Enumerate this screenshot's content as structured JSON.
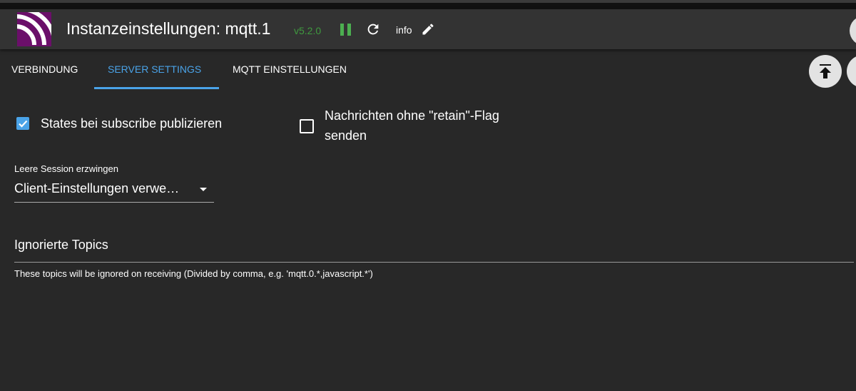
{
  "header": {
    "title": "Instanzeinstellungen: mqtt.1",
    "version": "v5.2.0",
    "info_label": "info",
    "icons": {
      "logo": "mqtt-logo",
      "pause": "pause-icon",
      "reload": "reload-icon",
      "edit": "pencil-icon"
    },
    "colors": {
      "version": "#3f9a3f",
      "pause": "#4caf50",
      "logo": "#6b0f6a"
    }
  },
  "tabs": [
    {
      "label": "VERBINDUNG",
      "active": false
    },
    {
      "label": "SERVER SETTINGS",
      "active": true
    },
    {
      "label": "MQTT EINSTELLUNGEN",
      "active": false
    }
  ],
  "accent": "#4aa3e8",
  "form": {
    "publish_on_subscribe": {
      "label": "States bei subscribe publizieren",
      "checked": true
    },
    "no_retain": {
      "label_line1": "Nachrichten ohne \"retain\"-Flag",
      "label_line2": "senden",
      "checked": false
    },
    "clean_session": {
      "label": "Leere Session erzwingen",
      "value": "Client-Einstellungen verwe…"
    },
    "ignored_topics": {
      "label": "Ignorierte Topics",
      "value": "",
      "help": "These topics will be ignored on receiving (Divided by comma, e.g. 'mqtt.0.*,javascript.*')"
    }
  }
}
